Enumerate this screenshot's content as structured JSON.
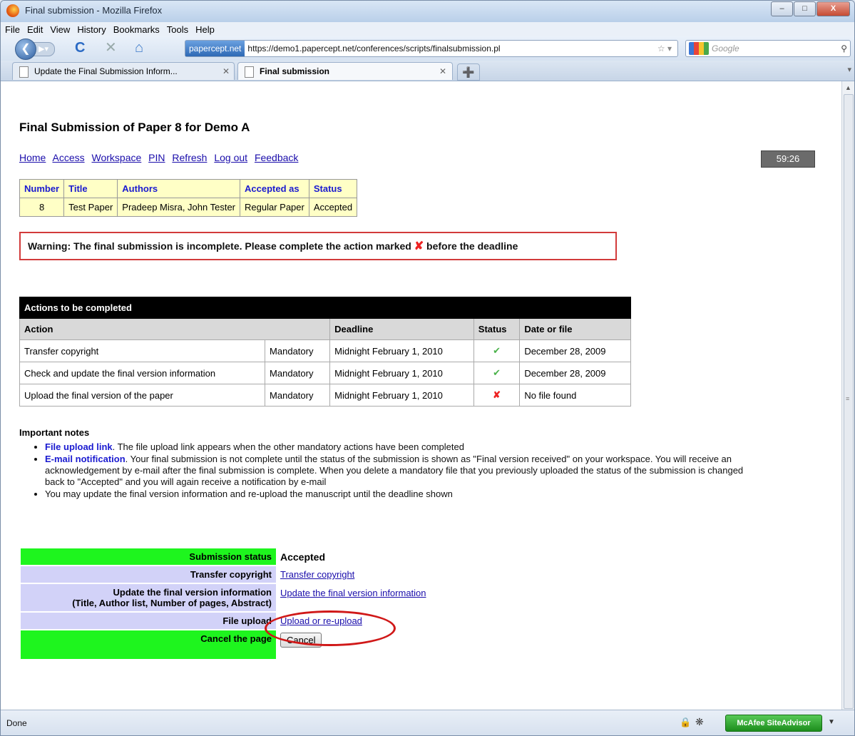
{
  "window": {
    "title": "Final submission - Mozilla Firefox",
    "controls": {
      "minimize": "–",
      "maximize": "□",
      "close": "X"
    }
  },
  "menu": [
    "File",
    "Edit",
    "View",
    "History",
    "Bookmarks",
    "Tools",
    "Help"
  ],
  "nav": {
    "site_identity": "papercept.net",
    "url": "https://demo1.papercept.net/conferences/scripts/finalsubmission.pl",
    "search_placeholder": "Google"
  },
  "tabs": [
    {
      "label": "Update the Final Submission Inform...",
      "active": false
    },
    {
      "label": "Final submission",
      "active": true
    }
  ],
  "page": {
    "title": "Final Submission of Paper 8 for Demo A",
    "links": [
      "Home",
      "Access",
      "Workspace",
      "PIN",
      "Refresh",
      "Log out",
      "Feedback"
    ],
    "timer": "59:26",
    "paper_table": {
      "headers": [
        "Number",
        "Title",
        "Authors",
        "Accepted as",
        "Status"
      ],
      "row": [
        "8",
        "Test Paper",
        "Pradeep Misra, John Tester",
        "Regular Paper",
        "Accepted"
      ]
    },
    "warning": {
      "before": "Warning: The final submission is incomplete. Please complete the action marked",
      "mark": "✘",
      "after": "before the deadline"
    },
    "actions": {
      "caption": "Actions to be completed",
      "headers": [
        "Action",
        "Deadline",
        "Status",
        "Date or file"
      ],
      "rows": [
        {
          "action": "Transfer copyright",
          "type": "Mandatory",
          "deadline": "Midnight February 1, 2010",
          "status": "✔",
          "date": "December 28, 2009"
        },
        {
          "action": "Check and update the final version information",
          "type": "Mandatory",
          "deadline": "Midnight February 1, 2010",
          "status": "✔",
          "date": "December 28, 2009"
        },
        {
          "action": "Upload the final version of the paper",
          "type": "Mandatory",
          "deadline": "Midnight February 1, 2010",
          "status": "✘",
          "date": "No file found"
        }
      ]
    },
    "notes": {
      "title": "Important notes",
      "items": [
        {
          "label": "File upload link",
          "text": ". The file upload link appears when the other mandatory actions have been completed"
        },
        {
          "label": "E-mail notification",
          "text": ". Your final submission is not complete until the status of the submission is shown as \"Final version received\" on your workspace. You will receive an acknowledgement by e-mail after the final submission is complete. When you delete a mandatory file that you previously uploaded the status of the submission is changed back to \"Accepted\" and you will again receive a notification by e-mail"
        },
        {
          "label": "",
          "text": "You may update the final version information and re-upload the manuscript until the deadline shown"
        }
      ]
    },
    "status_table": {
      "submission_status_label": "Submission status",
      "submission_status_value": "Accepted",
      "transfer_label": "Transfer copyright",
      "transfer_link": "Transfer copyright",
      "update_label": "Update the final version information",
      "update_sublabel": "(Title, Author list, Number of pages, Abstract)",
      "update_link": "Update the final version information",
      "upload_label": "File upload",
      "upload_link": "Upload or re-upload",
      "cancel_label": "Cancel the page",
      "cancel_button": "Cancel"
    }
  },
  "statusbar": {
    "text": "Done",
    "mcafee": "McAfee SiteAdvisor"
  },
  "colors": {
    "green_cell": "#1ef51e",
    "lavender_cell": "#d2d2f8",
    "paper_table_bg": "#ffffc6",
    "warning_border": "#d23b3b",
    "annotation_circle": "#d01818"
  }
}
